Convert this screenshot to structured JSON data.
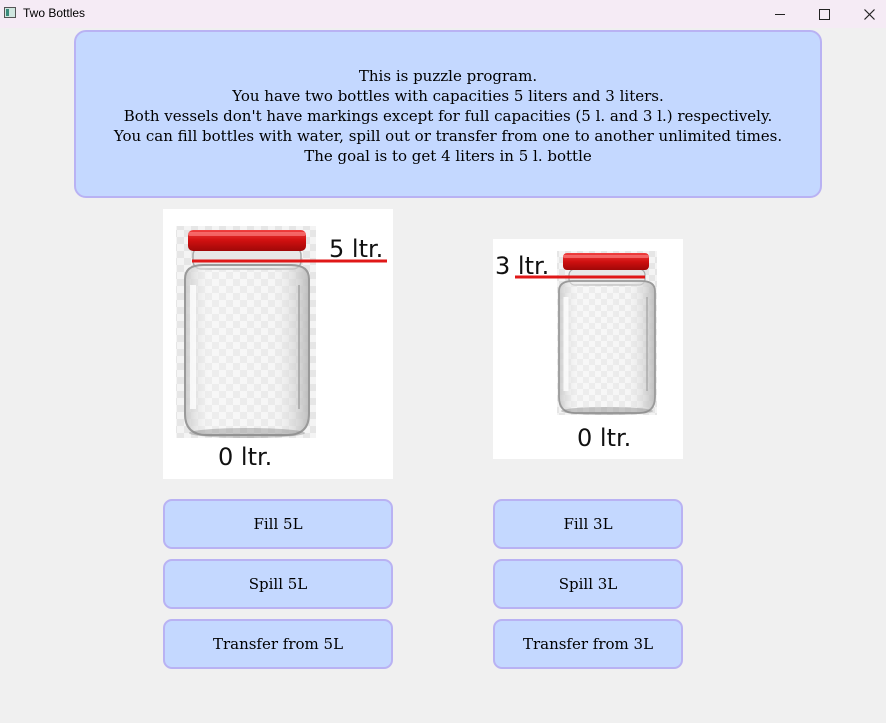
{
  "window": {
    "title": "Two Bottles",
    "controls": [
      "minimize-icon",
      "maximize-icon",
      "close-icon"
    ]
  },
  "info": {
    "lines": [
      "This is puzzle program.",
      "You have two bottles with capacities 5 liters and 3 liters.",
      "Both vessels don't have markings except for full capacities (5 l. and 3 l.) respectively.",
      "You can fill bottles with water, spill out or transfer from one to another unlimited times.",
      "The goal is to get 4 liters in 5 l. bottle"
    ]
  },
  "bottles": {
    "five": {
      "top_label": "5 ltr.",
      "bottom_label": "0 ltr."
    },
    "three": {
      "top_label": "3 ltr.",
      "bottom_label": "0 ltr."
    }
  },
  "actions": {
    "five": {
      "fill": "Fill 5L",
      "spill": "Spill 5L",
      "transfer": "Transfer from 5L"
    },
    "three": {
      "fill": "Fill 3L",
      "spill": "Spill 3L",
      "transfer": "Transfer from 3L"
    }
  },
  "colors": {
    "panel_fill": "#c4d8ff",
    "panel_border": "#b9b2f3",
    "lid_red": "#e01818",
    "marker_red": "#e01818"
  }
}
